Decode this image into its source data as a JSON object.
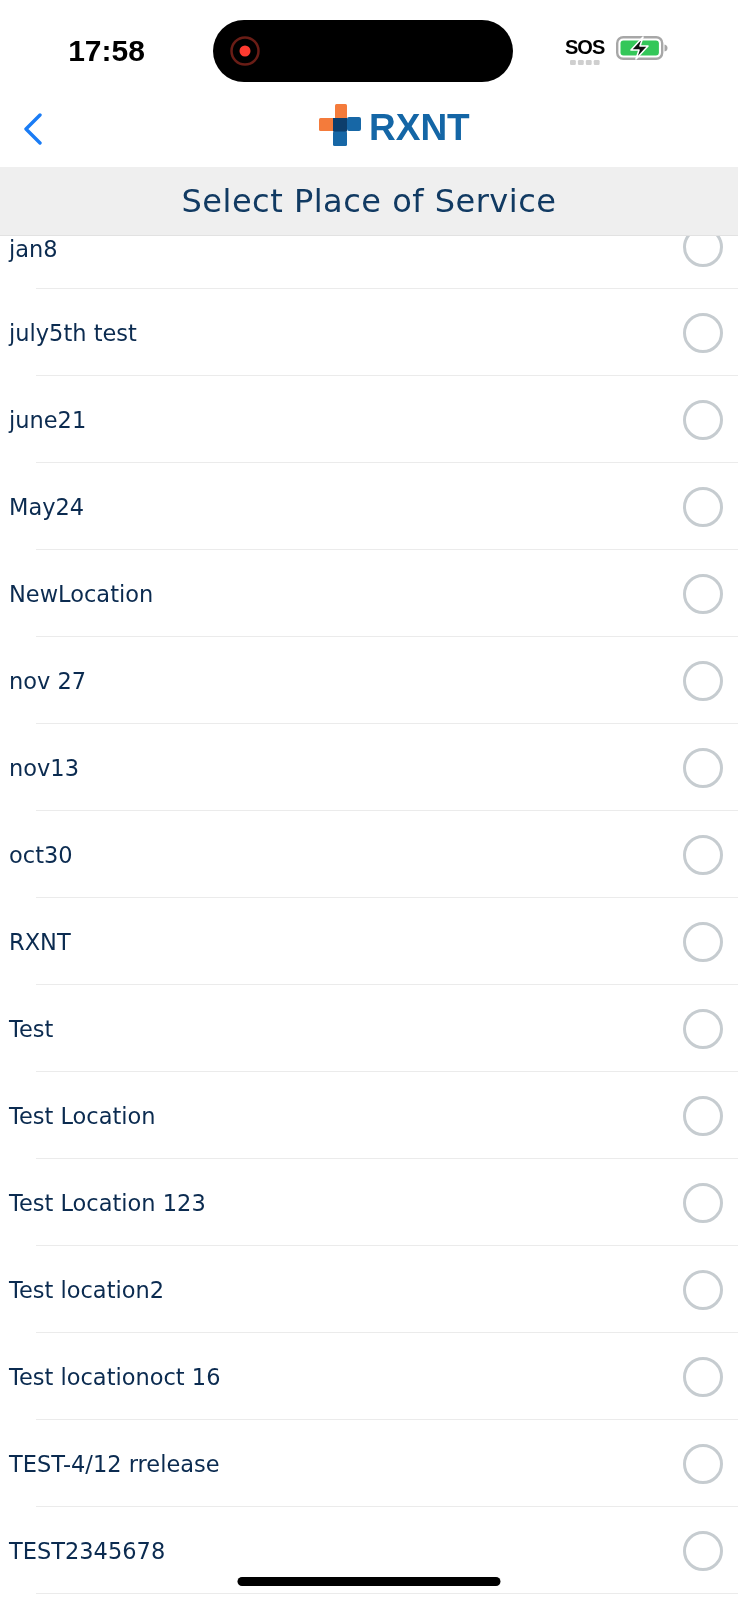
{
  "status_bar": {
    "time": "17:58",
    "carrier": "SOS"
  },
  "nav_bar": {
    "logo_text": "RXNT"
  },
  "header": {
    "title": "Select Place of Service"
  },
  "places": [
    {
      "name": "jan8",
      "selected": false
    },
    {
      "name": "july5th test",
      "selected": false
    },
    {
      "name": "june21",
      "selected": false
    },
    {
      "name": "May24",
      "selected": false
    },
    {
      "name": "NewLocation",
      "selected": false
    },
    {
      "name": "nov 27",
      "selected": false
    },
    {
      "name": "nov13",
      "selected": false
    },
    {
      "name": "oct30",
      "selected": false
    },
    {
      "name": "RXNT",
      "selected": false
    },
    {
      "name": "Test",
      "selected": false
    },
    {
      "name": "Test Location",
      "selected": false
    },
    {
      "name": "Test Location 123",
      "selected": false
    },
    {
      "name": "Test location2",
      "selected": false
    },
    {
      "name": "Test locationoct 16",
      "selected": false
    },
    {
      "name": "TEST-4/12 rrelease",
      "selected": false
    },
    {
      "name": "TEST2345678",
      "selected": false
    }
  ]
}
